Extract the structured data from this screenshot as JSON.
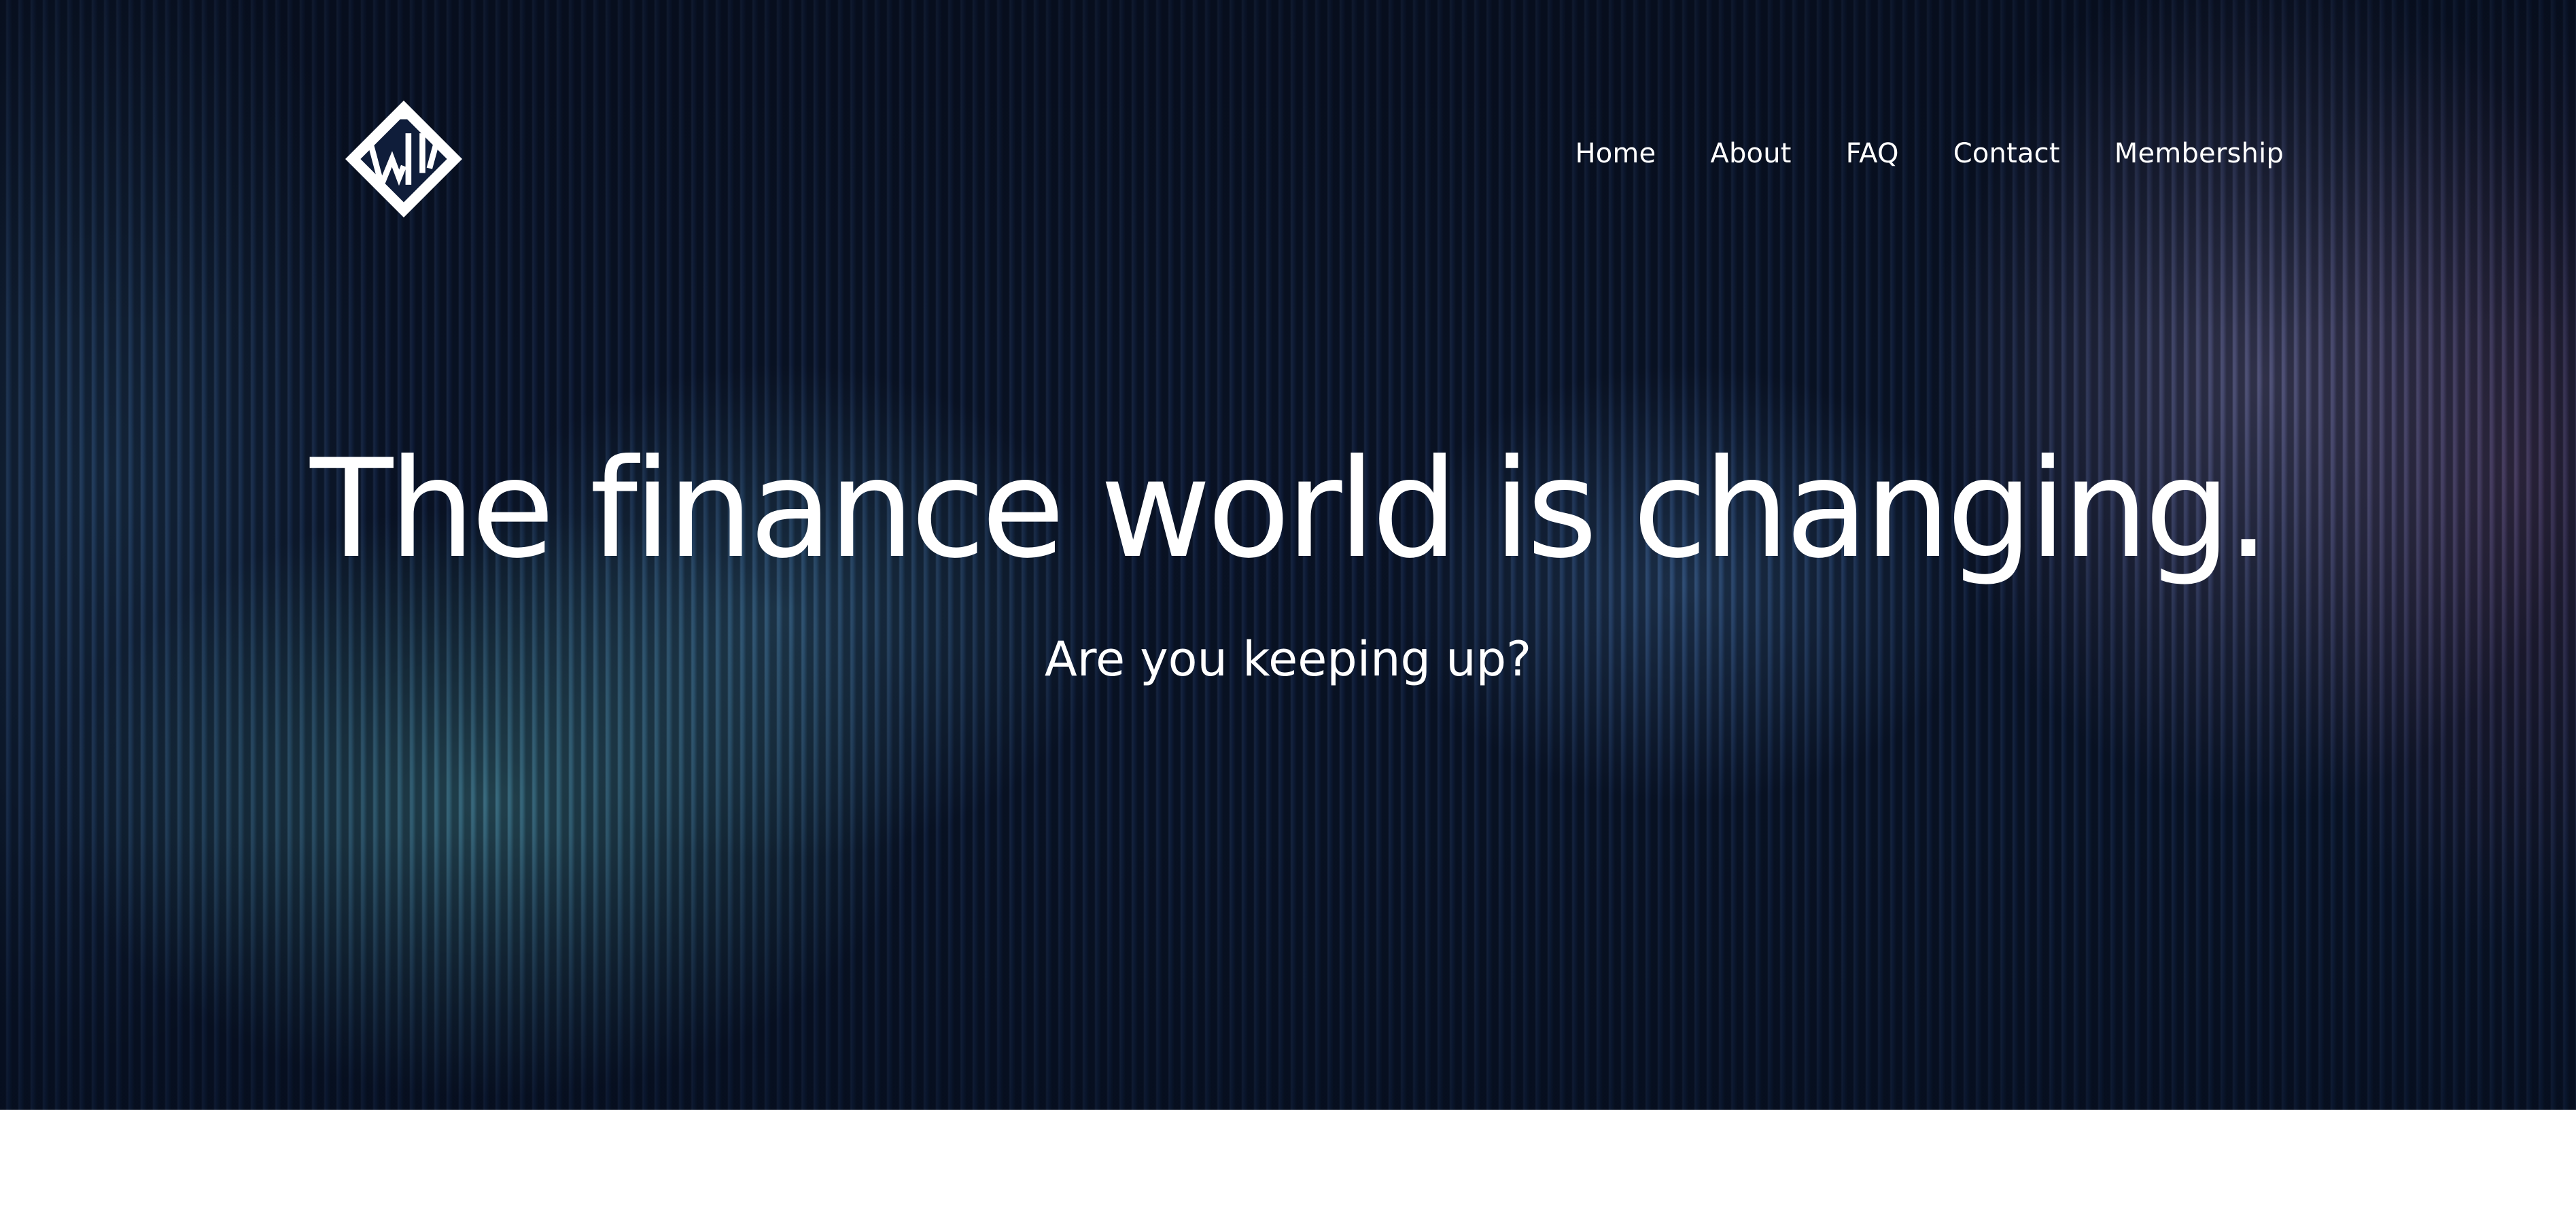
{
  "logo": {
    "icon": "diamond-w-logo-icon"
  },
  "nav": {
    "items": [
      {
        "label": "Home"
      },
      {
        "label": "About"
      },
      {
        "label": "FAQ"
      },
      {
        "label": "Contact"
      },
      {
        "label": "Membership"
      }
    ]
  },
  "hero": {
    "headline": "The finance world is changing.",
    "subheadline": "Are you keeping up?"
  },
  "colors": {
    "hero_background": "#0e1c38",
    "text": "#ffffff",
    "accent_teal": "#56a5b2",
    "accent_lilac": "#8c82b4",
    "page_background": "#ffffff"
  }
}
